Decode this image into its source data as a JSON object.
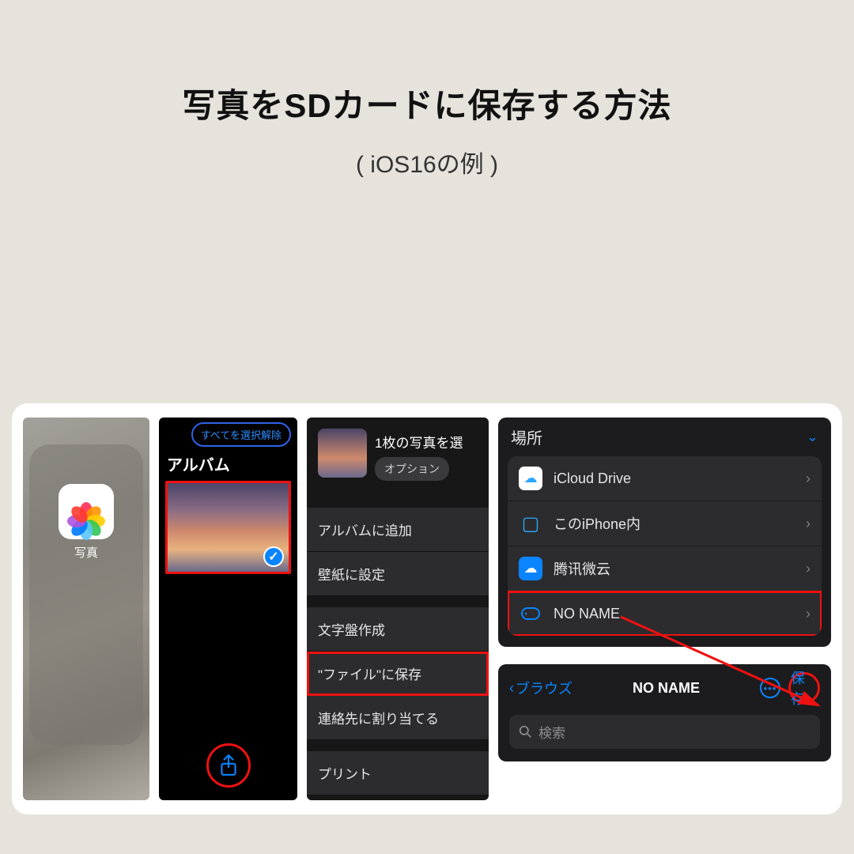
{
  "header": {
    "title": "写真をSDカードに保存する方法",
    "subtitle": "( iOS16の例 )"
  },
  "p1": {
    "app_label": "写真"
  },
  "p2": {
    "deselect": "すべてを選択解除",
    "album": "アルバム"
  },
  "p3": {
    "title": "1枚の写真を選",
    "options_btn": "オプション",
    "items": {
      "add_album": "アルバムに追加",
      "wallpaper": "壁紙に設定",
      "watchface": "文字盤作成",
      "save_files": "\"ファイル\"に保存",
      "assign_contact": "連絡先に割り当てる",
      "print": "プリント"
    }
  },
  "p4": {
    "locations_title": "場所",
    "rows": {
      "icloud": "iCloud Drive",
      "iphone": "このiPhone内",
      "tencent": "腾讯微云",
      "noname": "NO NAME"
    },
    "browse": {
      "back": "ブラウズ",
      "title": "NO NAME",
      "save": "保存",
      "search": "検索"
    }
  }
}
